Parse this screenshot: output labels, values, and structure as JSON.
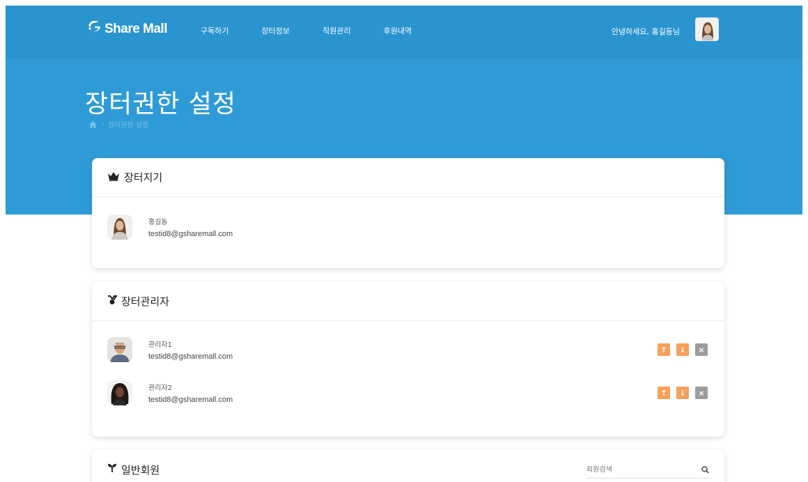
{
  "header": {
    "logo_text": "Share Mall",
    "nav": [
      "구독하기",
      "장터정보",
      "직원관리",
      "후원내역"
    ],
    "greeting": "안녕하세요, 홍길동님"
  },
  "page": {
    "title": "장터권한 설정",
    "breadcrumb_current": "장터권한 설정"
  },
  "owner_section": {
    "title": "장터지기",
    "member": {
      "name": "홍길동",
      "email": "testid8@gsharemall.com"
    }
  },
  "admin_section": {
    "title": "장터관리자",
    "members": [
      {
        "name": "관리자1",
        "email": "testid8@gsharemall.com"
      },
      {
        "name": "관리자2",
        "email": "testid8@gsharemall.com"
      }
    ],
    "buttons": {
      "up": "↑",
      "down": "↓",
      "remove": "×"
    }
  },
  "general_section": {
    "title": "일반회원",
    "search_placeholder": "회원검색"
  },
  "colors": {
    "header_blue": "#2a94cf",
    "hero_blue": "#2f9bd6",
    "accent_orange": "#f6a05a",
    "delete_gray": "#9c9c9c"
  }
}
